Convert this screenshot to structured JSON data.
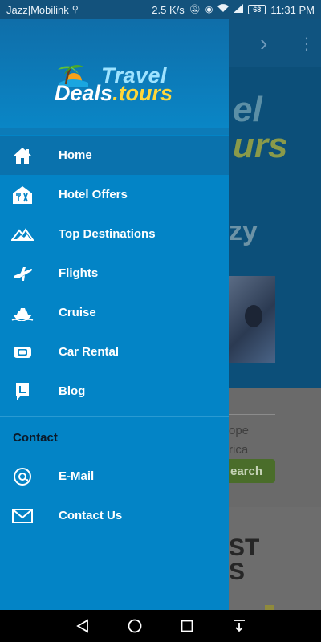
{
  "status_bar": {
    "carrier": "Jazz|Mobilink",
    "speed": "2.5 K/s",
    "battery": "68",
    "time": "11:31 PM"
  },
  "drawer": {
    "logo": {
      "line1": "Travel",
      "line2_a": "Deals",
      "line2_b": ".tours"
    },
    "items": [
      {
        "label": "Home",
        "icon": "home-icon",
        "active": true
      },
      {
        "label": "Hotel Offers",
        "icon": "hotel-icon",
        "active": false
      },
      {
        "label": "Top Destinations",
        "icon": "destinations-icon",
        "active": false
      },
      {
        "label": "Flights",
        "icon": "airplane-icon",
        "active": false
      },
      {
        "label": "Cruise",
        "icon": "ship-icon",
        "active": false
      },
      {
        "label": "Car Rental",
        "icon": "car-icon",
        "active": false
      },
      {
        "label": "Blog",
        "icon": "blog-icon",
        "active": false
      }
    ],
    "section_title": "Contact",
    "contact_items": [
      {
        "label": "E-Mail",
        "icon": "at-icon"
      },
      {
        "label": "Contact Us",
        "icon": "envelope-icon"
      }
    ]
  },
  "background": {
    "logo_frag_1": "el",
    "logo_frag_2": "urs",
    "heading_frag": "zy",
    "search_text_1": "ope",
    "search_text_2": "rica",
    "search_button": "earch",
    "big_text_1": "ST",
    "big_text_2": "S"
  },
  "colors": {
    "drawer_bg": "#0384c6",
    "active_item": "#0a72ad",
    "logo_yellow": "#ffd73a",
    "logo_light_blue": "#9ee3ff"
  }
}
